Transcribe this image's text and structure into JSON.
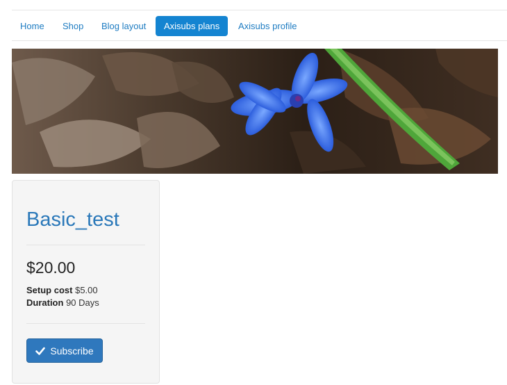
{
  "nav": {
    "items": [
      {
        "label": "Home",
        "active": false
      },
      {
        "label": "Shop",
        "active": false
      },
      {
        "label": "Blog layout",
        "active": false
      },
      {
        "label": "Axisubs plans",
        "active": true
      },
      {
        "label": "Axisubs profile",
        "active": false
      }
    ]
  },
  "banner": {
    "icon": "flower-photo"
  },
  "plan": {
    "title": "Basic_test",
    "price": "$20.00",
    "setup_label": "Setup cost",
    "setup_value": "$5.00",
    "duration_label": "Duration",
    "duration_value": "90 Days",
    "subscribe_label": "Subscribe",
    "subscribe_icon": "check-icon"
  },
  "colors": {
    "accent": "#1484d1",
    "link": "#1e7cc2",
    "title": "#2a78b9",
    "button": "#2f78bd"
  }
}
